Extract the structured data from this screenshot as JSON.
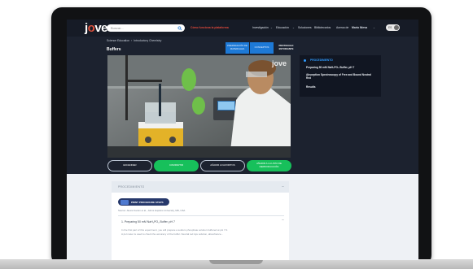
{
  "navbar": {
    "logo": "jove",
    "search": {
      "placeholder": "Buscar..."
    },
    "items": [
      {
        "label": "Cómo funciona la plataforma",
        "highlight": true
      },
      {
        "label": "Investigación",
        "highlight": false
      },
      {
        "label": "Educación",
        "highlight": false
      },
      {
        "label": "Soluciones",
        "highlight": false
      },
      {
        "label": "Bibliotecarios",
        "highlight": false
      },
      {
        "label": "Acerca de",
        "highlight": false
      },
      {
        "label": "Mario Nieva",
        "highlight": false
      }
    ],
    "language": "ES"
  },
  "breadcrumb": [
    "Science Education",
    "Introductory Chemistry"
  ],
  "page_title": "Buffers",
  "top_tabs": [
    {
      "label": "PREPARACIÓN DE MATERIALES",
      "active": false
    },
    {
      "label": "CONCEPTOS",
      "active": false
    },
    {
      "label": "PROTOCOLO ESTUDIANTE",
      "active": true
    }
  ],
  "video": {
    "watermark": "jove"
  },
  "actions": [
    {
      "label": "ENCENDER",
      "style": "outline"
    },
    {
      "label": "COMPARTIR",
      "style": "green"
    },
    {
      "label": "AÑADIR A FAVORITOS",
      "style": "outline"
    },
    {
      "label": "AÑADIR A LA LISTA DE REPRODUCCIÓN",
      "style": "green"
    }
  ],
  "sidebar": {
    "heading": "PROCEDIMIENTO",
    "links": [
      "Preparing 50 mM NaH₂PO₄ Buffer, pH 7",
      "Absorption Spectroscopy of Free and Bound Neutral Red",
      "Results"
    ]
  },
  "procedure": {
    "header": "PROCEDIMIENTO",
    "print_label": "PRINT PROCEDURE STEPS",
    "source": "Source: Alexis Kocsin et al., Johns Hopkins University, MD, USA",
    "step_title": "1. Preparing 50 mM NaH₂PO₄ Buffer, pH 7",
    "step_text": [
      "In the first part of this experiment, you will prepare a sodium phosphate solution buffered at pH 7.0.",
      "A pH meter is used to check the accuracy of the buffer. Neutral red dye solution, absorbance..."
    ]
  },
  "colors": {
    "accent_blue": "#1d79d6",
    "green": "#17c05b",
    "highlight_red": "#e34a3b",
    "navy": "#1c222f"
  }
}
